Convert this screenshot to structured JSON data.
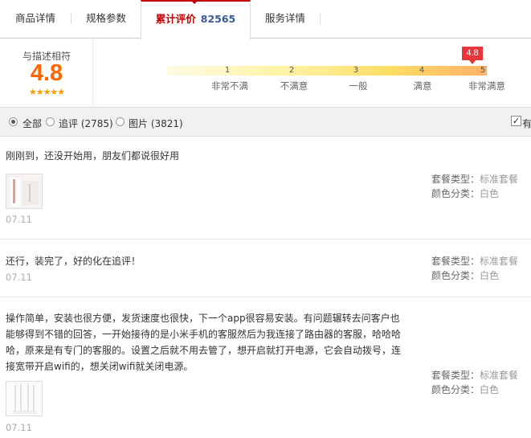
{
  "tabs": [
    {
      "label": "商品详情"
    },
    {
      "label": "规格参数"
    },
    {
      "label": "累计评价",
      "count": "82565"
    },
    {
      "label": "服务详情"
    }
  ],
  "rating": {
    "title": "与描述相符",
    "score": "4.8",
    "stars": "★★★★★",
    "flag_value": "4.8",
    "scale": [
      {
        "num": "1",
        "label": "非常不满"
      },
      {
        "num": "2",
        "label": "不满意"
      },
      {
        "num": "3",
        "label": "一般"
      },
      {
        "num": "4",
        "label": "满意"
      },
      {
        "num": "5",
        "label": "非常满意"
      }
    ]
  },
  "filter": {
    "all": "全部",
    "append": "追评 (2785)",
    "pics": "图片 (3821)",
    "checkbox_label": "有",
    "checked_mark": "✓"
  },
  "reviews": [
    {
      "text": "刚刚到，还没开始用，朋友们都说很好用",
      "date": "07.11",
      "package_key": "套餐类型：",
      "package_val": "标准套餐",
      "color_key": "颜色分类：",
      "color_val": "白色"
    },
    {
      "text": "还行，装完了，好的化在追评！",
      "date": "07.11",
      "package_key": "套餐类型：",
      "package_val": "标准套餐",
      "color_key": "颜色分类：",
      "color_val": "白色"
    },
    {
      "text": "操作简单，安装也很方便，发货速度也很快，下一个app很容易安装。有问题辗转去问客户也能够得到不错的回答，一开始接待的是小米手机的客服然后为我连接了路由器的客服，哈哈哈哈，原来是有专门的客服的。设置之后就不用去管了，想开启就打开电源，它会自动拨号，连接宽带开启wifi的，想关闭wifi就关闭电源。",
      "date": "07.11",
      "package_key": "套餐类型：",
      "package_val": "标准套餐",
      "color_key": "颜色分类：",
      "color_val": "白色"
    }
  ]
}
